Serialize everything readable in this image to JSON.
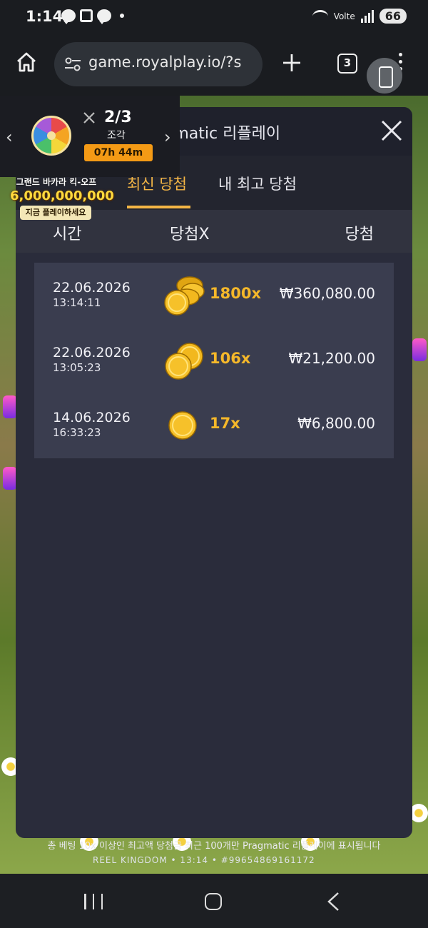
{
  "status_bar": {
    "time": "1:14",
    "battery": "66",
    "network_label": "Volte"
  },
  "browser": {
    "url": "game.royalplay.io/?s",
    "tab_count": "3"
  },
  "promo": {
    "count": "2/3",
    "unit": "조각",
    "timer": "07h 44m",
    "banner_title": "그랜드 바카라 킥-오프",
    "banner_amount": "6,000,000,000원",
    "banner_cta": "지금 플레이하세요"
  },
  "panel": {
    "title": "Pragmatic 리플레이",
    "tabs": [
      {
        "label": "최신 당첨",
        "active": true
      },
      {
        "label": "내 최고 당첨",
        "active": false
      }
    ],
    "columns": {
      "time": "시간",
      "multiplier": "당첨X",
      "win": "당첨"
    },
    "rows": [
      {
        "date": "22.06.2026",
        "time": "13:14:11",
        "multiplier": "1800x",
        "amount": "₩360,080.00",
        "coin_icon": "coin-stack-large-icon"
      },
      {
        "date": "22.06.2026",
        "time": "13:05:23",
        "multiplier": "106x",
        "amount": "₩21,200.00",
        "coin_icon": "coin-pair-icon"
      },
      {
        "date": "14.06.2026",
        "time": "16:33:23",
        "multiplier": "17x",
        "amount": "₩6,800.00",
        "coin_icon": "coin-single-icon"
      }
    ],
    "footer_note": "총 베팅 10x 이상인 최고액 당첨금 최근 100개만 Pragmatic 리플레이에 표시됩니다"
  },
  "game_footer": "REEL KINGDOM • 13:14 • #99654869161172",
  "colors": {
    "accent": "#f3b545",
    "panel_bg": "#2a2c3b",
    "row_bg": "#3a3d4f",
    "multiplier": "#f5b82a"
  }
}
